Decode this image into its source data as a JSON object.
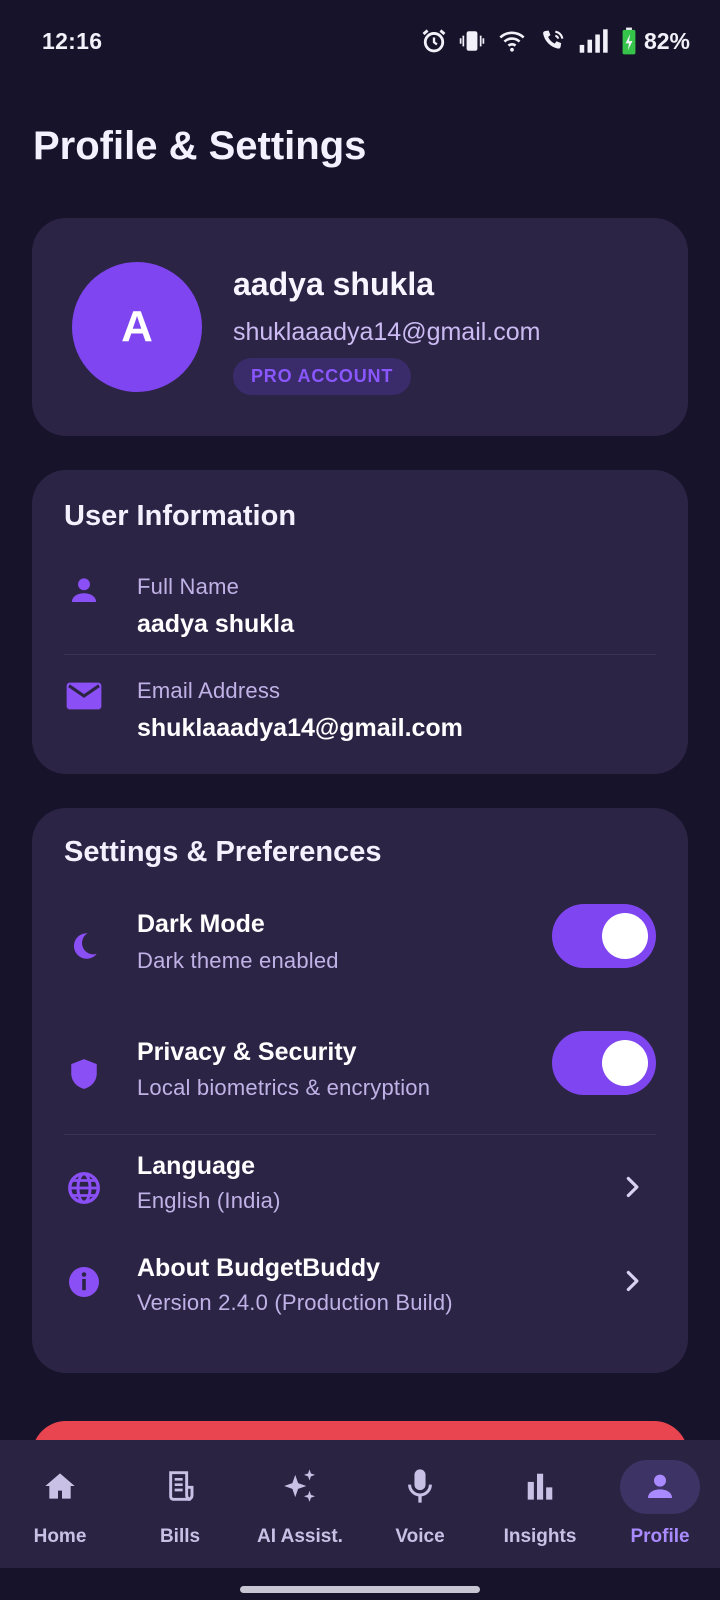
{
  "status_bar": {
    "time": "12:16",
    "battery_percent": "82%",
    "icons": [
      "alarm-icon",
      "vibrate-icon",
      "wifi-icon",
      "wifi-calling-icon",
      "signal-icon",
      "battery-charging-icon"
    ]
  },
  "page": {
    "title": "Profile & Settings"
  },
  "profile": {
    "avatar_initial": "A",
    "name": "aadya shukla",
    "email": "shuklaaadya14@gmail.com",
    "badge": "PRO ACCOUNT"
  },
  "user_info": {
    "title": "User Information",
    "full_name_label": "Full Name",
    "full_name_value": "aadya shukla",
    "email_label": "Email Address",
    "email_value": "shuklaaadya14@gmail.com"
  },
  "settings": {
    "title": "Settings & Preferences",
    "items": [
      {
        "icon": "moon-icon",
        "title": "Dark Mode",
        "subtitle": "Dark theme enabled",
        "control": "toggle",
        "enabled": true
      },
      {
        "icon": "shield-icon",
        "title": "Privacy & Security",
        "subtitle": "Local biometrics & encryption",
        "control": "toggle",
        "enabled": true
      },
      {
        "icon": "globe-icon",
        "title": "Language",
        "subtitle": "English (India)",
        "control": "chevron"
      },
      {
        "icon": "info-icon",
        "title": "About BudgetBuddy",
        "subtitle": "Version 2.4.0 (Production Build)",
        "control": "chevron"
      }
    ]
  },
  "nav": {
    "items": [
      {
        "label": "Home",
        "icon": "home-icon"
      },
      {
        "label": "Bills",
        "icon": "receipt-icon"
      },
      {
        "label": "AI Assist.",
        "icon": "sparkle-icon"
      },
      {
        "label": "Voice",
        "icon": "microphone-icon"
      },
      {
        "label": "Insights",
        "icon": "bar-chart-icon"
      },
      {
        "label": "Profile",
        "icon": "person-icon",
        "active": true
      }
    ]
  },
  "colors": {
    "background": "#17132a",
    "card": "#2c2445",
    "accent": "#7f45f0",
    "logout_red": "#e84550",
    "nav_active": "#a98bff"
  }
}
